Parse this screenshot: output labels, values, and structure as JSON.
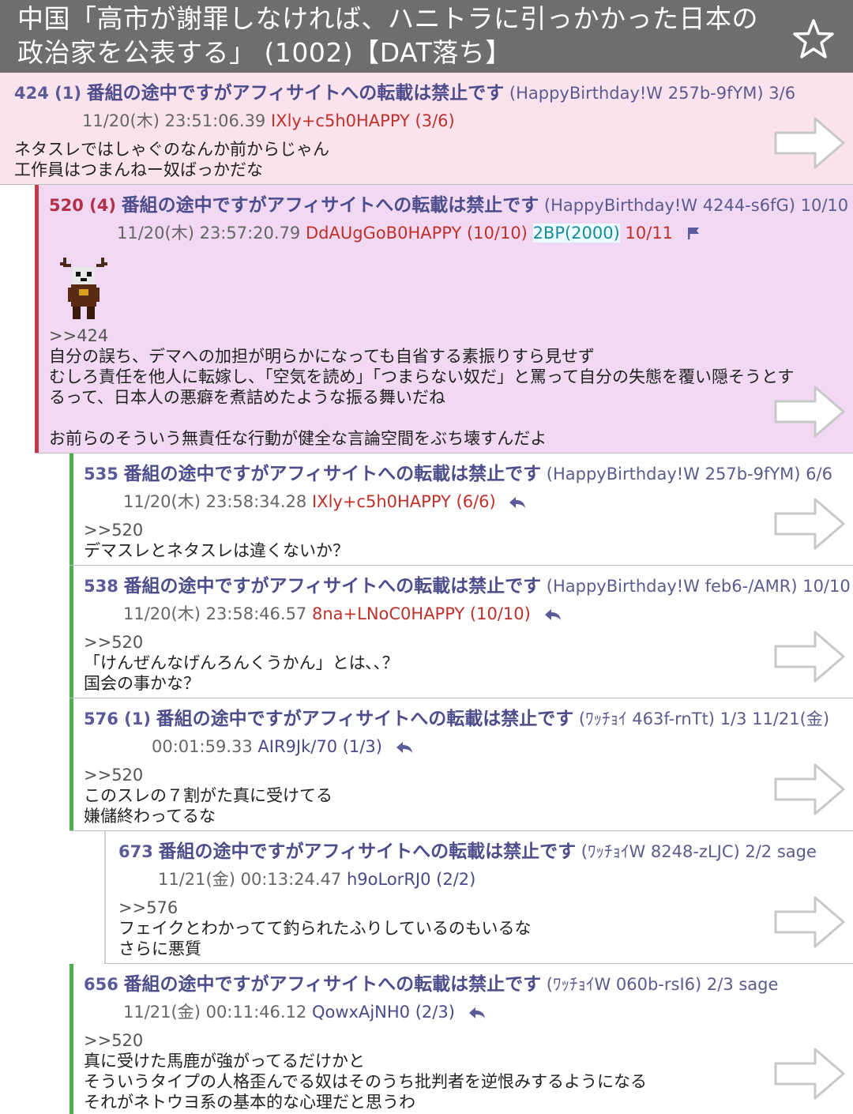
{
  "header": {
    "title": "中国「高市が謝罪しなければ、ハニトラに引っかかった日本の政治家を公表する」 (1002)【DAT落ち】",
    "star_icon": "star-outline-icon"
  },
  "posts": [
    {
      "num": "424 (1)",
      "name": "番組の途中ですがアフィサイトへの転載は禁止です",
      "trip": "(HappyBirthday!W 257b-9fYM) 3/6",
      "datetime": "11/20(木) 23:51:06.39",
      "id": "IXly+c5h0HAPPY (3/6)",
      "body": "ネタスレではしゃぐのなんか前からじゃん\n工作員はつまんねー奴ばっかだな",
      "bg": "#fbe3ee"
    },
    {
      "num": "520 (4)",
      "name": "番組の途中ですがアフィサイトへの転載は禁止です",
      "trip": "(HappyBirthday!W 4244-s6fG) 10/10",
      "datetime": "11/20(木) 23:57:20.79",
      "id": "DdAUgGoB0HAPPY (10/10)",
      "bp": "2BP(2000)",
      "count": "10/11",
      "anchor": ">>424",
      "body": "自分の誤ち、デマへの加担が明らかになっても自省する素振りすら見せず\nむしろ責任を他人に転嫁し、「空気を読め」「つまらない奴だ」と罵って自分の失態を覆い隠そうとす\nるって、日本人の悪癖を煮詰めたような振る舞いだね\n\nお前らのそういう無責任な行動が健全な言論空間をぶち壊すんだよ",
      "bg": "#f1d8f3",
      "bar": "#c03a4a"
    },
    {
      "num": "535",
      "name": "番組の途中ですがアフィサイトへの転載は禁止です",
      "trip": "(HappyBirthday!W 257b-9fYM) 6/6",
      "datetime": "11/20(木) 23:58:34.28",
      "id": "IXly+c5h0HAPPY (6/6)",
      "anchor": ">>520",
      "body": "デマスレとネタスレは違くないか？",
      "bar": "#4caf50"
    },
    {
      "num": "538",
      "name": "番組の途中ですがアフィサイトへの転載は禁止です",
      "trip": "(HappyBirthday!W feb6-/AMR) 10/10",
      "datetime": "11/20(木) 23:58:46.57",
      "id": "8na+LNoC0HAPPY (10/10)",
      "anchor": ">>520",
      "body": "「けんぜんなげんろんくうかん」とは､､？\n国会の事かな？",
      "bar": "#4caf50"
    },
    {
      "num": "576 (1)",
      "name": "番組の途中ですがアフィサイトへの転載は禁止です",
      "trip": "(ﾜｯﾁｮｲ 463f-rnTt) 1/3  11/21(金)",
      "datetime": "00:01:59.33",
      "id": "AIR9Jk/70 (1/3)",
      "anchor": ">>520",
      "body": "このスレの７割がた真に受けてる\n嫌儲終わってるな",
      "bar": "#4caf50"
    },
    {
      "num": "673",
      "name": "番組の途中ですがアフィサイトへの転載は禁止です",
      "trip": "(ﾜｯﾁｮｲW 8248-zLJC) 2/2 sage",
      "datetime": "11/21(金) 00:13:24.47",
      "id": "h9oLorRJ0 (2/2)",
      "anchor": ">>576",
      "body": "フェイクとわかってて釣られたふりしているのもいるな\nさらに悪質",
      "bar": "#d0d0d0"
    },
    {
      "num": "656",
      "name": "番組の途中ですがアフィサイトへの転載は禁止です",
      "trip": "(ﾜｯﾁｮｲW 060b-rsI6) 2/3 sage",
      "datetime": "11/21(金) 00:11:46.12",
      "id": "QowxAjNH0 (2/3)",
      "anchor": ">>520",
      "body": "真に受けた馬鹿が強がってるだけかと\nそういうタイプの人格歪んでる奴はそのうち批判者を逆恨みするようになる\nそれがネトウヨ系の基本的な心理だと思うわ",
      "bar": "#4caf50"
    }
  ],
  "icons": {
    "arrow": "arrow-right-outline-icon",
    "reply": "reply-icon",
    "flag": "flag-icon",
    "avatar": "reindeer-avatar-icon"
  }
}
